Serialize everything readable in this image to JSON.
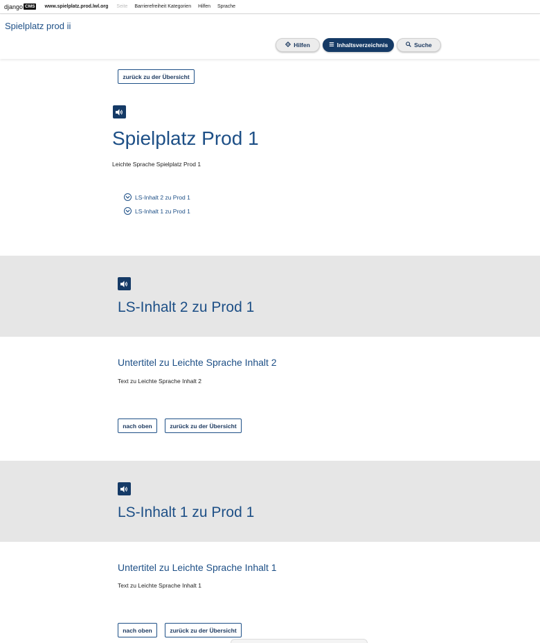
{
  "cms_toolbar": {
    "logo_text": "django",
    "logo_badge": "CMS",
    "site_url": "www.spielplatz.prod.lwl.org",
    "menu": [
      "Seite",
      "Barrierefreiheit Kategorien",
      "Hilfen",
      "Sprache"
    ]
  },
  "header": {
    "site_title": "Spielplatz prod ii",
    "buttons": {
      "hilfen": "Hilfen",
      "toc": "Inhaltsverzeichnis",
      "suche": "Suche"
    }
  },
  "intro": {
    "back_button": "zurück zu der Übersicht",
    "title": "Spielplatz Prod 1",
    "subtitle": "Leichte Sprache Spielplatz Prod 1",
    "toc_links": [
      "LS-Inhalt 2 zu Prod 1",
      "LS-Inhalt 1 zu Prod 1"
    ]
  },
  "sections": [
    {
      "heading": "LS-Inhalt 2 zu Prod 1",
      "subheading": "Untertitel zu Leichte Sprache Inhalt 2",
      "text": "Text zu Leichte Sprache Inhalt 2",
      "top_button": "nach oben",
      "back_button": "zurück zu der Übersicht"
    },
    {
      "heading": "LS-Inhalt 1 zu Prod 1",
      "subheading": "Untertitel zu Leichte Sprache Inhalt 1",
      "text": "Text zu Leichte Sprache Inhalt 1",
      "top_button": "nach oben",
      "back_button": "zurück zu der Übersicht"
    }
  ],
  "colors": {
    "primary": "#1d4f86",
    "dark": "#153a66",
    "band": "#e6e6e6"
  },
  "icons": {
    "speaker": "speaker-icon",
    "gear": "gear-icon",
    "menu": "menu-lines-icon",
    "search": "search-icon",
    "chevron": "chevron-down-circle-icon"
  }
}
